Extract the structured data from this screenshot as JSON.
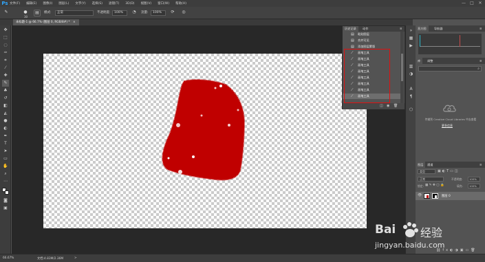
{
  "menubar": {
    "logo": "Ps",
    "items": [
      "文件(F)",
      "编辑(E)",
      "图像(I)",
      "图层(L)",
      "文字(Y)",
      "选择(S)",
      "滤镜(T)",
      "3D(D)",
      "视图(V)",
      "窗口(W)",
      "帮助(H)"
    ],
    "min": "—",
    "max": "□",
    "close": "✕"
  },
  "options": {
    "size": "30",
    "mode_label": "模式:",
    "mode_value": "正常",
    "opacity_label": "不透明度:",
    "opacity_value": "100%",
    "flow_label": "流量:",
    "flow_value": "100%"
  },
  "document": {
    "tab_title": "未标题-1 @ 66.7% (图层 0, RGB/8#) *",
    "tab_close": "×"
  },
  "history": {
    "tabs": [
      "历史记录",
      "动作"
    ],
    "rows": [
      "粘贴图层",
      "合并可见",
      "添加图层蒙版",
      "画笔工具",
      "画笔工具",
      "画笔工具",
      "画笔工具",
      "画笔工具",
      "画笔工具",
      "画笔工具",
      "画笔工具"
    ],
    "active_index": 10
  },
  "right": {
    "nav_tabs": [
      "直方图",
      "导航器"
    ],
    "lib_tabs": [
      "库",
      "调整"
    ],
    "cc_text": "传输到 Creative Cloud Libraries 中去查看",
    "cc_link": "更多信息",
    "layer_tabs": [
      "图层",
      "通道"
    ],
    "kind_label": "类型",
    "blend_value": "正常",
    "opacity_label": "不透明度:",
    "opacity_value": "100%",
    "lock_label": "锁定:",
    "fill_label": "填充:",
    "fill_value": "100%",
    "layer_name": "图层 0"
  },
  "status": {
    "zoom": "66.67%",
    "doc": "文档:4.83M/2.36M",
    "arrow": ">"
  },
  "watermark": {
    "brand": "Bai",
    "brand2": "经验",
    "url": "jingyan.baidu.com"
  },
  "colors": {
    "accent": "#31a8ff",
    "shape_red": "#c00000",
    "highlight_box": "#e01010"
  }
}
